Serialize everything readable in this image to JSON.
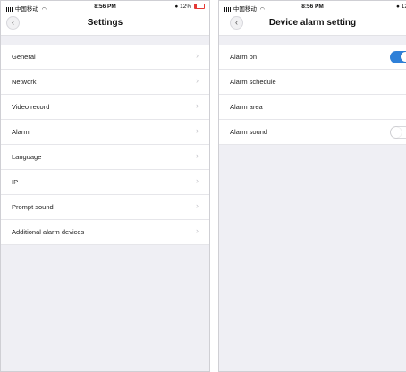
{
  "left_screen": {
    "status_bar": {
      "carrier": "中国移动",
      "time": "8:56 PM",
      "battery": "12%"
    },
    "nav_title": "Settings",
    "items": [
      {
        "label": "General"
      },
      {
        "label": "Network"
      },
      {
        "label": "Video record"
      },
      {
        "label": "Alarm"
      },
      {
        "label": "Language"
      },
      {
        "label": "IP"
      },
      {
        "label": "Prompt sound"
      },
      {
        "label": "Additional alarm devices"
      }
    ]
  },
  "right_screen": {
    "status_bar": {
      "carrier": "中国移动",
      "time": "8:56 PM",
      "battery": "12"
    },
    "nav_title": "Device alarm setting",
    "items": [
      {
        "label": "Alarm on",
        "toggle": "on"
      },
      {
        "label": "Alarm schedule"
      },
      {
        "label": "Alarm area"
      },
      {
        "label": "Alarm sound",
        "toggle": "off"
      }
    ]
  },
  "colors": {
    "accent": "#2f80d8",
    "background": "#efeff4",
    "battery_low": "#e53935"
  }
}
